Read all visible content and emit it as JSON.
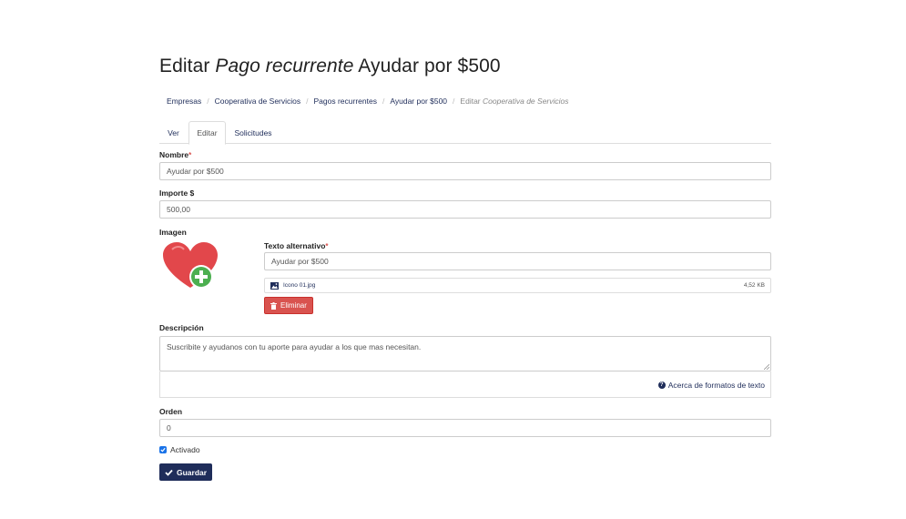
{
  "title": {
    "prefix": "Editar",
    "italic": "Pago recurrente",
    "suffix": "Ayudar por $500"
  },
  "breadcrumb": {
    "items": [
      "Empresas",
      "Cooperativa de Servicios",
      "Pagos recurrentes",
      "Ayudar por $500"
    ],
    "current_prefix": "Editar",
    "current_italic": "Cooperativa de Servicios"
  },
  "tabs": [
    {
      "label": "Ver",
      "active": false
    },
    {
      "label": "Editar",
      "active": true
    },
    {
      "label": "Solicitudes",
      "active": false
    }
  ],
  "form": {
    "nombre": {
      "label": "Nombre",
      "required_mark": "*",
      "value": "Ayudar por $500"
    },
    "importe": {
      "label": "Importe $",
      "value": "500,00"
    },
    "imagen": {
      "label": "Imagen",
      "alt_label": "Texto alternativo",
      "alt_required_mark": "*",
      "alt_value": "Ayudar por $500",
      "file_name": "Icono 01.jpg",
      "file_size": "4,52 KB",
      "delete_label": "Eliminar"
    },
    "descripcion": {
      "label": "Descripción",
      "value": "Suscribite y ayudanos con tu aporte para ayudar a los que mas necesitan.",
      "help_label": "Acerca de formatos de texto"
    },
    "orden": {
      "label": "Orden",
      "value": "0"
    },
    "activado": {
      "label": "Activado",
      "checked": true
    },
    "save_label": "Guardar"
  },
  "colors": {
    "primary": "#1f2d5a",
    "danger": "#d9534f",
    "heart": "#e2474b",
    "plus": "#4caf50"
  }
}
